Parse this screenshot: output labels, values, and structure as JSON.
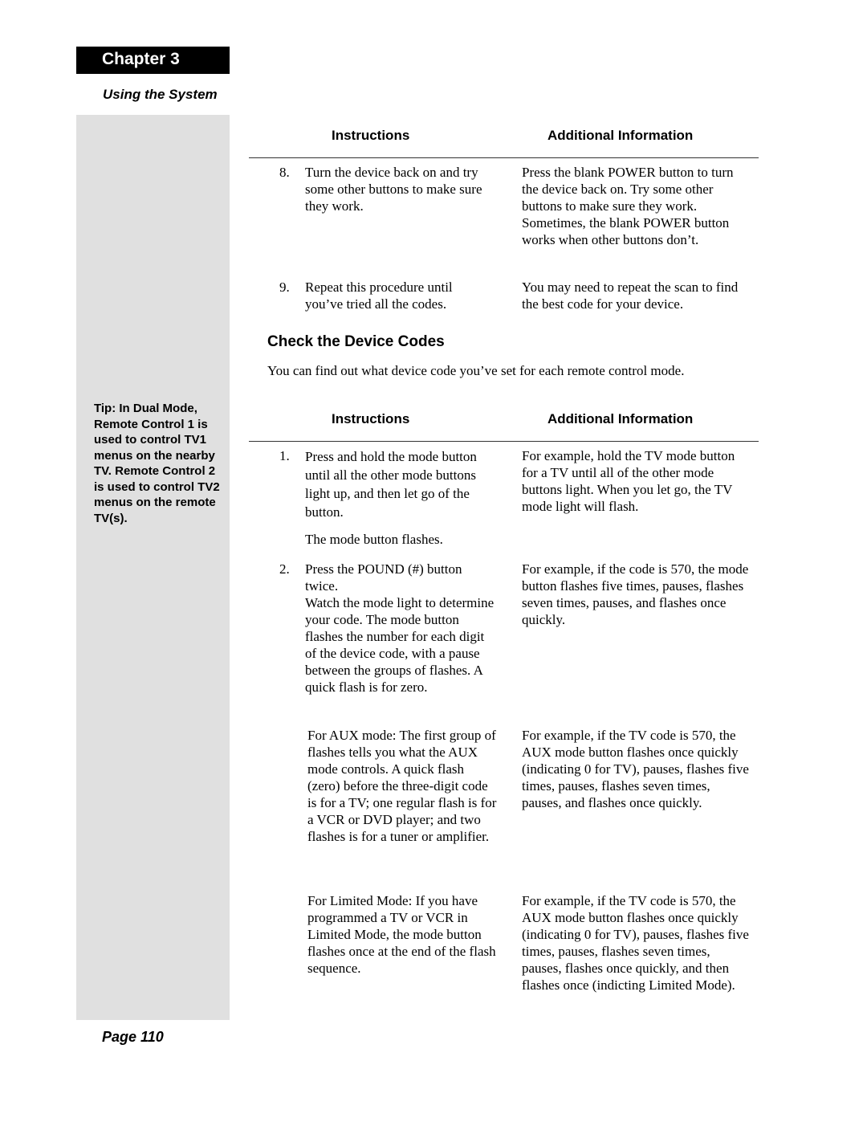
{
  "chapter": "Chapter 3",
  "section": "Using the System",
  "tip": "Tip: In Dual Mode, Remote Control 1 is used to control TV1 menus on the nearby TV. Remote Control 2 is used to control TV2 menus on the remote TV(s).",
  "page": "Page 110",
  "table1": {
    "headers": {
      "instructions": "Instructions",
      "additional": "Additional Information"
    },
    "rows": [
      {
        "num": "8.",
        "instruction": "Turn the device back on and try some other buttons to make sure they work.",
        "info": "Press the blank POWER button to turn the device back on. Try some other buttons to make sure they work. Sometimes, the blank POWER button works when other buttons don’t."
      },
      {
        "num": "9.",
        "instruction": "Repeat this procedure until you’ve tried all the codes.",
        "info": "You may need to repeat the scan to find the best code for your device."
      }
    ]
  },
  "heading": "Check the Device Codes",
  "intro": "You can find out what device code you’ve set for each remote control mode.",
  "table2": {
    "headers": {
      "instructions": "Instructions",
      "additional": "Additional Information"
    },
    "rows": [
      {
        "num": "1.",
        "instruction": "Press and hold the mode button until all the other mode buttons light up, and then let go of the button.",
        "result": "The mode button flashes.",
        "info": "For example, hold the TV mode button for a TV until all of the other mode buttons light. When you let go, the TV mode light will flash."
      },
      {
        "num": "2.",
        "instruction": "Press the POUND (#) button twice.",
        "instruction_cont": "Watch the mode light to determine your code. The mode button flashes the number for each digit of the device code, with a pause between the groups of flashes. A quick flash is for zero.",
        "info": "For example, if the code is 570, the mode button flashes five times, pauses, flashes seven times, pauses, and flashes once quickly."
      },
      {
        "num": "",
        "instruction": "For AUX mode: The first group of flashes tells you what the AUX mode controls. A quick flash (zero) before the three-digit code is for a TV; one regular flash is for a VCR or DVD player; and two flashes is for a tuner or amplifier.",
        "info": "For example, if the TV code is 570, the AUX mode button flashes once quickly (indicating 0 for TV), pauses, flashes five times, pauses, flashes seven times, pauses, and flashes once quickly."
      },
      {
        "num": "",
        "instruction": "For Limited Mode: If you have programmed a TV or VCR in Limited Mode, the mode button flashes once at the end of the flash sequence.",
        "info": "For example, if the TV code is 570, the AUX mode button flashes once quickly (indicating 0 for TV), pauses, flashes five times, pauses, flashes seven times, pauses, flashes once quickly, and then flashes once (indicting Limited Mode)."
      }
    ]
  }
}
